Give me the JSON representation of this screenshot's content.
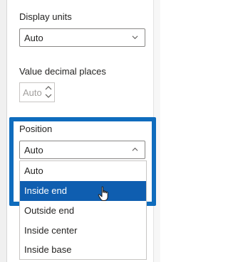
{
  "display_units": {
    "label": "Display units",
    "value": "Auto"
  },
  "decimal_places": {
    "label": "Value decimal places",
    "value": "Auto"
  },
  "position": {
    "label": "Position",
    "value": "Auto",
    "options": [
      "Auto",
      "Inside end",
      "Outside end",
      "Inside center",
      "Inside base"
    ],
    "highlighted": "Inside end"
  },
  "colors": {
    "accent": "#0f6cbd",
    "selected_bg": "#0f5eb0",
    "border": "#8a8886"
  },
  "icons": [
    "chevron-down-icon",
    "chevron-up-icon",
    "spin-up-icon",
    "spin-down-icon",
    "hand-pointer-icon"
  ]
}
